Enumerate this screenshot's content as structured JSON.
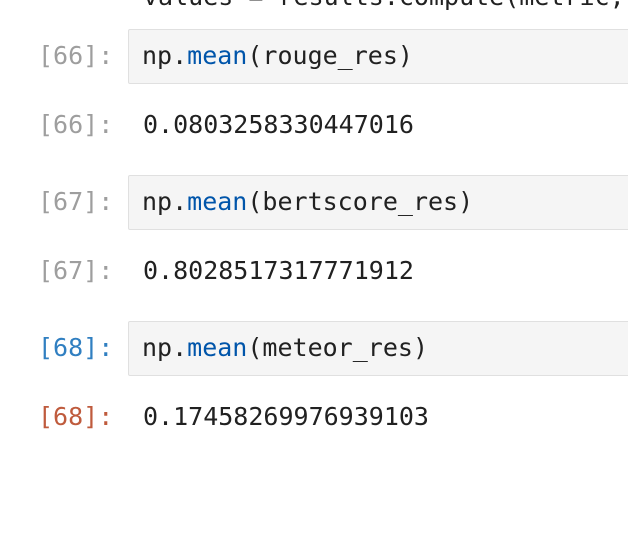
{
  "top_partial_line": "values = results.compute(metric, ... )",
  "cells": [
    {
      "input_prompt": "[66]:",
      "code": {
        "prefix": "np.",
        "function": "mean",
        "args": "(rouge_res)"
      },
      "output_prompt": "[66]:",
      "output": "0.0803258330447016"
    },
    {
      "input_prompt": "[67]:",
      "code": {
        "prefix": "np.",
        "function": "mean",
        "args": "(bertscore_res)"
      },
      "output_prompt": "[67]:",
      "output": "0.8028517317771912"
    },
    {
      "input_prompt": "[68]:",
      "code": {
        "prefix": "np.",
        "function": "mean",
        "args": "(meteor_res)"
      },
      "output_prompt": "[68]:",
      "output": "0.17458269976939103"
    }
  ]
}
